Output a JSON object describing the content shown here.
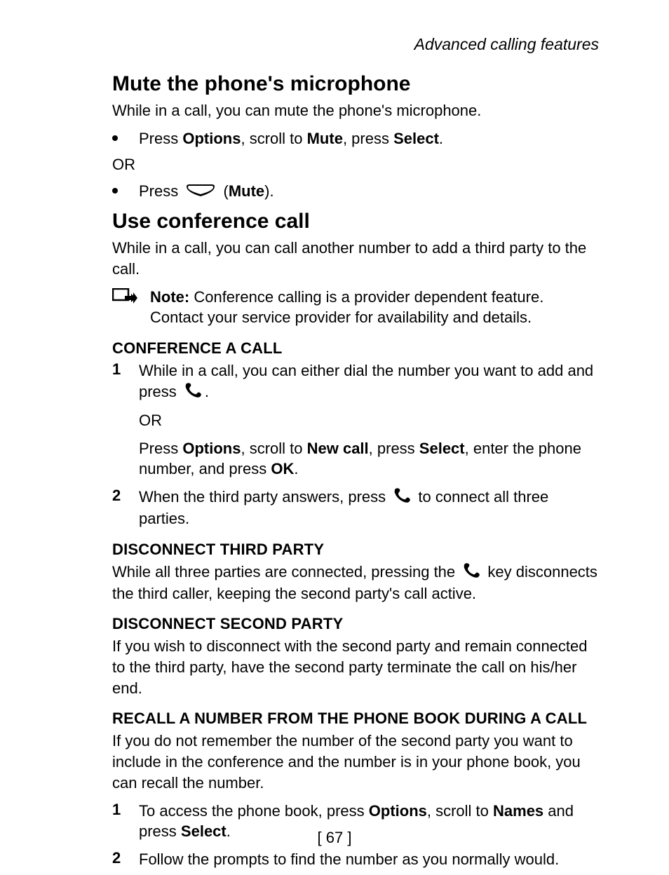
{
  "header": {
    "chapter": "Advanced calling features"
  },
  "sections": {
    "mute": {
      "title": "Mute the phone's microphone",
      "intro": "While in a call, you can mute the phone's microphone.",
      "bullet1_pre": "Press ",
      "bullet1_k1": "Options",
      "bullet1_mid1": ", scroll to ",
      "bullet1_k2": "Mute",
      "bullet1_mid2": ", press ",
      "bullet1_k3": "Select",
      "bullet1_end": ".",
      "or": "OR",
      "bullet2_pre": "Press ",
      "bullet2_paren_open": " (",
      "bullet2_k1": "Mute",
      "bullet2_paren_close": ")."
    },
    "conf": {
      "title": "Use conference call",
      "intro": "While in a call, you can call another number to add a third party to the call.",
      "note_label": "Note:",
      "note_body": " Conference calling is a provider dependent feature. Contact your service provider for availability and details.",
      "sub1": "CONFERENCE A CALL",
      "step1_pre": "While in a call, you can either dial the number you want to add and press ",
      "step1_end": ".",
      "step1_or": "OR",
      "step1_alt_pre": "Press ",
      "step1_alt_k1": "Options",
      "step1_alt_mid1": ", scroll to ",
      "step1_alt_k2": "New call",
      "step1_alt_mid2": ", press ",
      "step1_alt_k3": "Select",
      "step1_alt_mid3": ", enter the phone number, and press ",
      "step1_alt_k4": "OK",
      "step1_alt_end": ".",
      "step2_pre": "When the third party answers, press ",
      "step2_end": " to connect all three parties.",
      "sub2": "DISCONNECT THIRD PARTY",
      "disc3_pre": "While all three parties are connected, pressing the ",
      "disc3_end": " key disconnects the third caller, keeping the second party's call active.",
      "sub3": "DISCONNECT SECOND PARTY",
      "disc2": "If you wish to disconnect with the second party and remain connected to the third party, have the second party terminate the call on his/her end.",
      "sub4": "RECALL A NUMBER FROM THE PHONE BOOK DURING A CALL",
      "recall_intro": "If you do not remember the number of the second party you want to include in the conference and the number is in your phone book, you can recall the number.",
      "recall1_pre": "To access the phone book, press ",
      "recall1_k1": "Options",
      "recall1_mid1": ", scroll to ",
      "recall1_k2": "Names",
      "recall1_mid2": " and press ",
      "recall1_k3": "Select",
      "recall1_end": ".",
      "recall2": "Follow the prompts to find the number as you normally would."
    }
  },
  "nums": {
    "n1": "1",
    "n2": "2"
  },
  "footer": {
    "page": "[ 67 ]"
  },
  "icons": {
    "softkey": "softkey-icon",
    "call": "call-key-icon",
    "note": "note-icon"
  }
}
